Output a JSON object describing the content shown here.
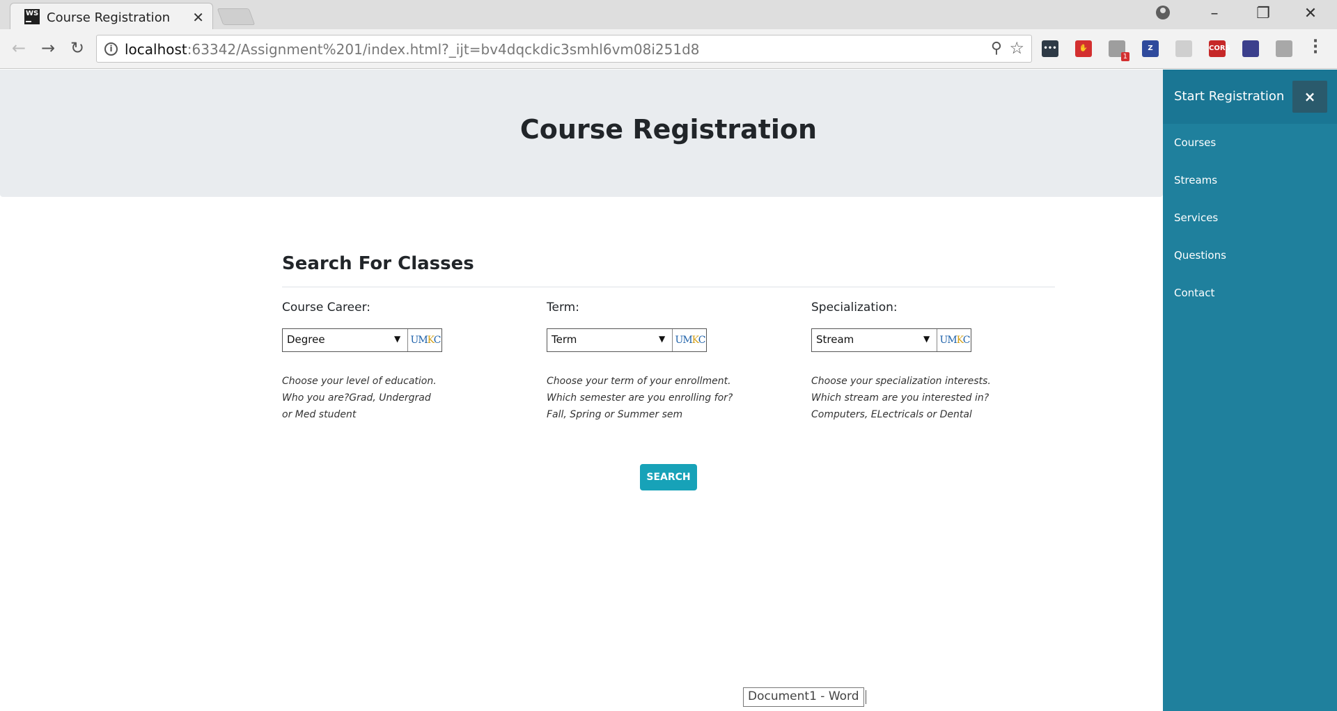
{
  "browser": {
    "tab_title": "Course Registration",
    "tab_close": "✕",
    "url_host": "localhost",
    "url_rest": ":63342/Assignment%201/index.html?_ijt=bv4dqckdic3smhl6vm08i251d8",
    "extensions": [
      {
        "name": "dots-extension-icon",
        "label": "•••",
        "color": "#2e3a46"
      },
      {
        "name": "adblock-extension-icon",
        "label": "✋",
        "color": "#d32f2f"
      },
      {
        "name": "shield-extension-icon",
        "label": "",
        "color": "#9e9e9e",
        "badge": "1"
      },
      {
        "name": "zotero-extension-icon",
        "label": "Z",
        "color": "#2f4a9c"
      },
      {
        "name": "swirl-extension-icon",
        "label": "",
        "color": "#cfcfcf"
      },
      {
        "name": "cors-extension-icon",
        "label": "CORS",
        "color": "#c62828"
      },
      {
        "name": "chart-extension-icon",
        "label": "",
        "color": "#3b3f8c"
      },
      {
        "name": "figure-extension-icon",
        "label": "",
        "color": "#a8a8a8"
      }
    ]
  },
  "header": {
    "title": "Course Registration"
  },
  "search": {
    "heading": "Search For Classes",
    "button_label": "SEARCH",
    "fields": [
      {
        "label": "Course Career:",
        "selected": "Degree",
        "logo": "UMKC",
        "help": [
          "Choose your level of education.",
          "Who you are?Grad, Undergrad",
          "or Med student"
        ]
      },
      {
        "label": "Term:",
        "selected": "Term",
        "logo": "UMKC",
        "help": [
          "Choose your term of your enrollment.",
          "Which semester are you enrolling for?",
          "Fall, Spring or Summer sem"
        ]
      },
      {
        "label": "Specialization:",
        "selected": "Stream",
        "logo": "UMKC",
        "help": [
          "Choose your specialization interests.",
          "Which stream are you interested in?",
          "Computers, ELectricals or Dental"
        ]
      }
    ]
  },
  "sidenav": {
    "title": "Start Registration",
    "close": "×",
    "links": [
      "Courses",
      "Streams",
      "Services",
      "Questions",
      "Contact"
    ],
    "background": "#1f809d"
  },
  "tooltip": {
    "text": "Document1 - Word"
  },
  "colors": {
    "accent": "#17a2b8",
    "jumbotron": "#e9ecef"
  }
}
